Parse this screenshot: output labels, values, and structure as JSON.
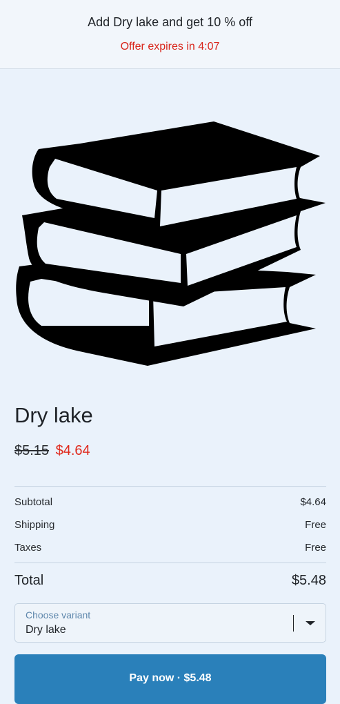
{
  "banner": {
    "title": "Add Dry lake and get 10 % off",
    "timer": "Offer expires in 4:07"
  },
  "product": {
    "image_icon": "books-stack-icon",
    "name": "Dry lake",
    "old_price": "$5.15",
    "new_price": "$4.64"
  },
  "summary": {
    "subtotal_label": "Subtotal",
    "subtotal_value": "$4.64",
    "shipping_label": "Shipping",
    "shipping_value": "Free",
    "taxes_label": "Taxes",
    "taxes_value": "Free",
    "total_label": "Total",
    "total_value": "$5.48"
  },
  "variant": {
    "label": "Choose variant",
    "selected": "Dry lake"
  },
  "pay": {
    "label": "Pay now · $5.48"
  },
  "colors": {
    "accent": "#2a80ba",
    "sale": "#e02a1d",
    "background": "#eaf2fb"
  }
}
